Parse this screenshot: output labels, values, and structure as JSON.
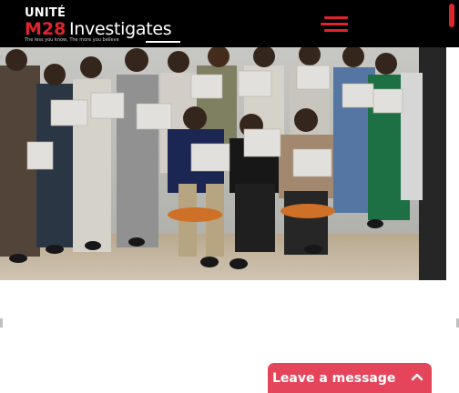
{
  "header": {
    "logo": {
      "line1": "UNITÉ",
      "brand_red": "M28",
      "brand_white": "Investigates",
      "tagline": "The less you know, The more you believe"
    },
    "menu_icon": "hamburger-menu-icon"
  },
  "hero": {
    "image_description": "Group photo of people holding certificates"
  },
  "chat": {
    "label": "Leave a message",
    "icon": "chevron-up-icon"
  },
  "colors": {
    "header_bg": "#000000",
    "brand_red": "#e0242c",
    "chat_bg": "#e5455b"
  }
}
